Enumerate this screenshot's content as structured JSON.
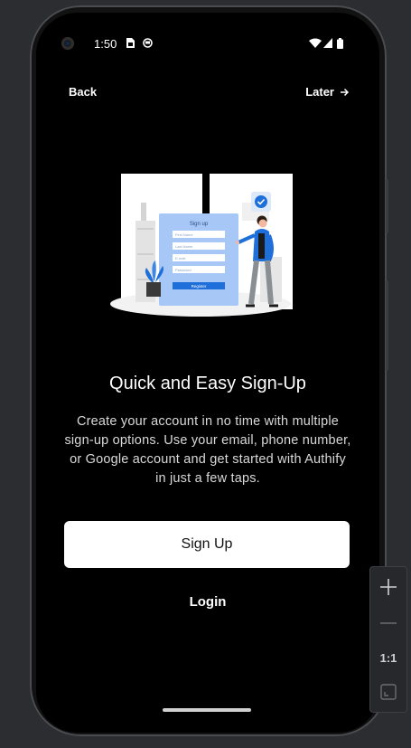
{
  "status_bar": {
    "time": "1:50"
  },
  "nav": {
    "back_label": "Back",
    "later_label": "Later"
  },
  "illustration": {
    "form_title": "Sign up",
    "fields": [
      "First Name",
      "Last Name",
      "E-mail",
      "Password"
    ],
    "register_label": "Register"
  },
  "content": {
    "title": "Quick and Easy Sign-Up",
    "description": "Create your account in no time with multiple sign-up options. Use your email, phone number, or Google account and get started with Authify in just a few taps."
  },
  "actions": {
    "signup_label": "Sign Up",
    "login_label": "Login"
  },
  "zoom_panel": {
    "reset_label": "1:1"
  },
  "colors": {
    "background": "#000000",
    "accent": "#1e6fd9",
    "button_bg": "#ffffff"
  }
}
